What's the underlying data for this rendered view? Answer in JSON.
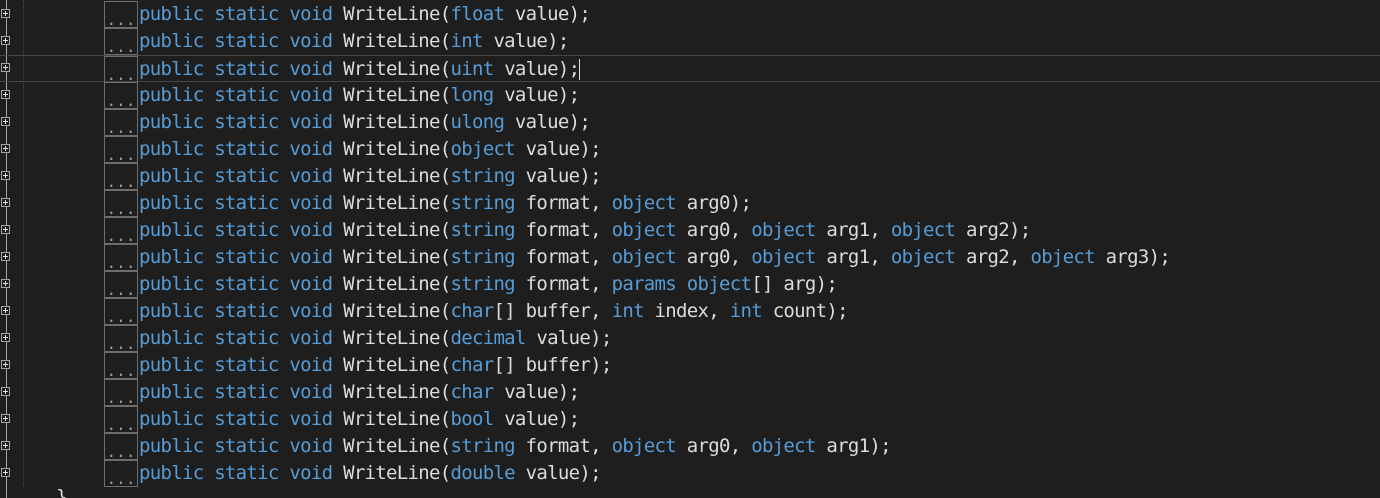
{
  "editor": {
    "collapsed_marker": "...",
    "closing_brace": "}",
    "lines": [
      {
        "tokens": [
          {
            "t": "public",
            "k": 1
          },
          {
            "t": " ",
            "k": 0
          },
          {
            "t": "static",
            "k": 1
          },
          {
            "t": " ",
            "k": 0
          },
          {
            "t": "void",
            "k": 1
          },
          {
            "t": " WriteLine(",
            "k": 0
          },
          {
            "t": "float",
            "k": 1
          },
          {
            "t": " value);",
            "k": 0
          }
        ]
      },
      {
        "tokens": [
          {
            "t": "public",
            "k": 1
          },
          {
            "t": " ",
            "k": 0
          },
          {
            "t": "static",
            "k": 1
          },
          {
            "t": " ",
            "k": 0
          },
          {
            "t": "void",
            "k": 1
          },
          {
            "t": " WriteLine(",
            "k": 0
          },
          {
            "t": "int",
            "k": 1
          },
          {
            "t": " value);",
            "k": 0
          }
        ]
      },
      {
        "current": true,
        "tokens": [
          {
            "t": "public",
            "k": 1
          },
          {
            "t": " ",
            "k": 0
          },
          {
            "t": "static",
            "k": 1
          },
          {
            "t": " ",
            "k": 0
          },
          {
            "t": "void",
            "k": 1
          },
          {
            "t": " WriteLine(",
            "k": 0
          },
          {
            "t": "uint",
            "k": 1
          },
          {
            "t": " value);",
            "k": 0
          }
        ]
      },
      {
        "tokens": [
          {
            "t": "public",
            "k": 1
          },
          {
            "t": " ",
            "k": 0
          },
          {
            "t": "static",
            "k": 1
          },
          {
            "t": " ",
            "k": 0
          },
          {
            "t": "void",
            "k": 1
          },
          {
            "t": " WriteLine(",
            "k": 0
          },
          {
            "t": "long",
            "k": 1
          },
          {
            "t": " value);",
            "k": 0
          }
        ]
      },
      {
        "tokens": [
          {
            "t": "public",
            "k": 1
          },
          {
            "t": " ",
            "k": 0
          },
          {
            "t": "static",
            "k": 1
          },
          {
            "t": " ",
            "k": 0
          },
          {
            "t": "void",
            "k": 1
          },
          {
            "t": " WriteLine(",
            "k": 0
          },
          {
            "t": "ulong",
            "k": 1
          },
          {
            "t": " value);",
            "k": 0
          }
        ]
      },
      {
        "tokens": [
          {
            "t": "public",
            "k": 1
          },
          {
            "t": " ",
            "k": 0
          },
          {
            "t": "static",
            "k": 1
          },
          {
            "t": " ",
            "k": 0
          },
          {
            "t": "void",
            "k": 1
          },
          {
            "t": " WriteLine(",
            "k": 0
          },
          {
            "t": "object",
            "k": 1
          },
          {
            "t": " value);",
            "k": 0
          }
        ]
      },
      {
        "tokens": [
          {
            "t": "public",
            "k": 1
          },
          {
            "t": " ",
            "k": 0
          },
          {
            "t": "static",
            "k": 1
          },
          {
            "t": " ",
            "k": 0
          },
          {
            "t": "void",
            "k": 1
          },
          {
            "t": " WriteLine(",
            "k": 0
          },
          {
            "t": "string",
            "k": 1
          },
          {
            "t": " value);",
            "k": 0
          }
        ]
      },
      {
        "tokens": [
          {
            "t": "public",
            "k": 1
          },
          {
            "t": " ",
            "k": 0
          },
          {
            "t": "static",
            "k": 1
          },
          {
            "t": " ",
            "k": 0
          },
          {
            "t": "void",
            "k": 1
          },
          {
            "t": " WriteLine(",
            "k": 0
          },
          {
            "t": "string",
            "k": 1
          },
          {
            "t": " format, ",
            "k": 0
          },
          {
            "t": "object",
            "k": 1
          },
          {
            "t": " arg0);",
            "k": 0
          }
        ]
      },
      {
        "tokens": [
          {
            "t": "public",
            "k": 1
          },
          {
            "t": " ",
            "k": 0
          },
          {
            "t": "static",
            "k": 1
          },
          {
            "t": " ",
            "k": 0
          },
          {
            "t": "void",
            "k": 1
          },
          {
            "t": " WriteLine(",
            "k": 0
          },
          {
            "t": "string",
            "k": 1
          },
          {
            "t": " format, ",
            "k": 0
          },
          {
            "t": "object",
            "k": 1
          },
          {
            "t": " arg0, ",
            "k": 0
          },
          {
            "t": "object",
            "k": 1
          },
          {
            "t": " arg1, ",
            "k": 0
          },
          {
            "t": "object",
            "k": 1
          },
          {
            "t": " arg2);",
            "k": 0
          }
        ]
      },
      {
        "tokens": [
          {
            "t": "public",
            "k": 1
          },
          {
            "t": " ",
            "k": 0
          },
          {
            "t": "static",
            "k": 1
          },
          {
            "t": " ",
            "k": 0
          },
          {
            "t": "void",
            "k": 1
          },
          {
            "t": " WriteLine(",
            "k": 0
          },
          {
            "t": "string",
            "k": 1
          },
          {
            "t": " format, ",
            "k": 0
          },
          {
            "t": "object",
            "k": 1
          },
          {
            "t": " arg0, ",
            "k": 0
          },
          {
            "t": "object",
            "k": 1
          },
          {
            "t": " arg1, ",
            "k": 0
          },
          {
            "t": "object",
            "k": 1
          },
          {
            "t": " arg2, ",
            "k": 0
          },
          {
            "t": "object",
            "k": 1
          },
          {
            "t": " arg3);",
            "k": 0
          }
        ]
      },
      {
        "tokens": [
          {
            "t": "public",
            "k": 1
          },
          {
            "t": " ",
            "k": 0
          },
          {
            "t": "static",
            "k": 1
          },
          {
            "t": " ",
            "k": 0
          },
          {
            "t": "void",
            "k": 1
          },
          {
            "t": " WriteLine(",
            "k": 0
          },
          {
            "t": "string",
            "k": 1
          },
          {
            "t": " format, ",
            "k": 0
          },
          {
            "t": "params",
            "k": 1
          },
          {
            "t": " ",
            "k": 0
          },
          {
            "t": "object",
            "k": 1
          },
          {
            "t": "[] arg);",
            "k": 0
          }
        ]
      },
      {
        "tokens": [
          {
            "t": "public",
            "k": 1
          },
          {
            "t": " ",
            "k": 0
          },
          {
            "t": "static",
            "k": 1
          },
          {
            "t": " ",
            "k": 0
          },
          {
            "t": "void",
            "k": 1
          },
          {
            "t": " WriteLine(",
            "k": 0
          },
          {
            "t": "char",
            "k": 1
          },
          {
            "t": "[] buffer, ",
            "k": 0
          },
          {
            "t": "int",
            "k": 1
          },
          {
            "t": " index, ",
            "k": 0
          },
          {
            "t": "int",
            "k": 1
          },
          {
            "t": " count);",
            "k": 0
          }
        ]
      },
      {
        "tokens": [
          {
            "t": "public",
            "k": 1
          },
          {
            "t": " ",
            "k": 0
          },
          {
            "t": "static",
            "k": 1
          },
          {
            "t": " ",
            "k": 0
          },
          {
            "t": "void",
            "k": 1
          },
          {
            "t": " WriteLine(",
            "k": 0
          },
          {
            "t": "decimal",
            "k": 1
          },
          {
            "t": " value);",
            "k": 0
          }
        ]
      },
      {
        "tokens": [
          {
            "t": "public",
            "k": 1
          },
          {
            "t": " ",
            "k": 0
          },
          {
            "t": "static",
            "k": 1
          },
          {
            "t": " ",
            "k": 0
          },
          {
            "t": "void",
            "k": 1
          },
          {
            "t": " WriteLine(",
            "k": 0
          },
          {
            "t": "char",
            "k": 1
          },
          {
            "t": "[] buffer);",
            "k": 0
          }
        ]
      },
      {
        "tokens": [
          {
            "t": "public",
            "k": 1
          },
          {
            "t": " ",
            "k": 0
          },
          {
            "t": "static",
            "k": 1
          },
          {
            "t": " ",
            "k": 0
          },
          {
            "t": "void",
            "k": 1
          },
          {
            "t": " WriteLine(",
            "k": 0
          },
          {
            "t": "char",
            "k": 1
          },
          {
            "t": " value);",
            "k": 0
          }
        ]
      },
      {
        "tokens": [
          {
            "t": "public",
            "k": 1
          },
          {
            "t": " ",
            "k": 0
          },
          {
            "t": "static",
            "k": 1
          },
          {
            "t": " ",
            "k": 0
          },
          {
            "t": "void",
            "k": 1
          },
          {
            "t": " WriteLine(",
            "k": 0
          },
          {
            "t": "bool",
            "k": 1
          },
          {
            "t": " value);",
            "k": 0
          }
        ]
      },
      {
        "tokens": [
          {
            "t": "public",
            "k": 1
          },
          {
            "t": " ",
            "k": 0
          },
          {
            "t": "static",
            "k": 1
          },
          {
            "t": " ",
            "k": 0
          },
          {
            "t": "void",
            "k": 1
          },
          {
            "t": " WriteLine(",
            "k": 0
          },
          {
            "t": "string",
            "k": 1
          },
          {
            "t": " format, ",
            "k": 0
          },
          {
            "t": "object",
            "k": 1
          },
          {
            "t": " arg0, ",
            "k": 0
          },
          {
            "t": "object",
            "k": 1
          },
          {
            "t": " arg1);",
            "k": 0
          }
        ]
      },
      {
        "tokens": [
          {
            "t": "public",
            "k": 1
          },
          {
            "t": " ",
            "k": 0
          },
          {
            "t": "static",
            "k": 1
          },
          {
            "t": " ",
            "k": 0
          },
          {
            "t": "void",
            "k": 1
          },
          {
            "t": " WriteLine(",
            "k": 0
          },
          {
            "t": "double",
            "k": 1
          },
          {
            "t": " value);",
            "k": 0
          }
        ]
      }
    ]
  },
  "colors": {
    "background": "#1e1e1e",
    "keyword": "#569cd6",
    "plain": "#dcdcdc"
  }
}
